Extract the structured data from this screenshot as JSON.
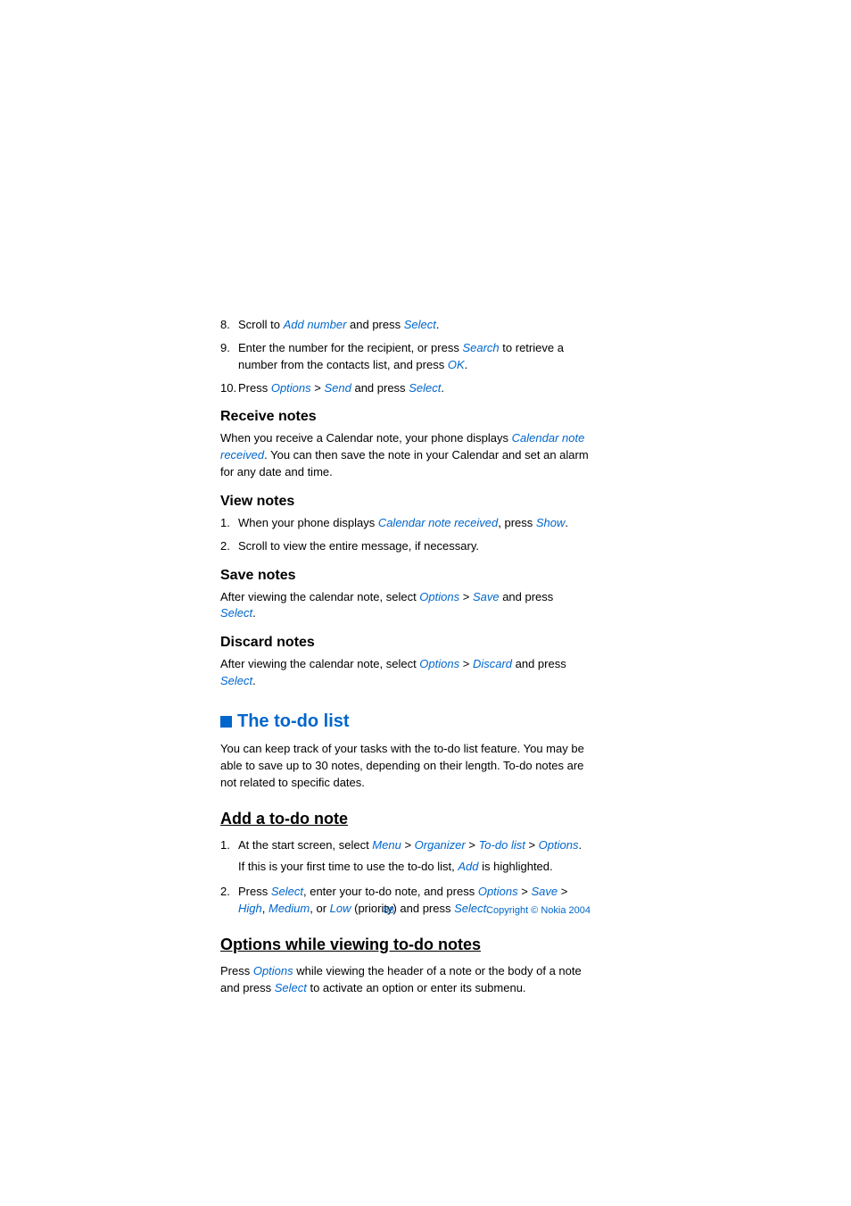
{
  "step8": {
    "num": "8.",
    "t1": "Scroll to ",
    "link1": "Add number",
    "t2": " and press ",
    "link2": "Select",
    "t3": "."
  },
  "step9": {
    "num": "9.",
    "t1": "Enter the number for the recipient, or press ",
    "link1": "Search",
    "t2": " to retrieve a number from the contacts list, and press ",
    "link2": "OK",
    "t3": "."
  },
  "step10": {
    "num": "10.",
    "t1": "Press ",
    "link1": "Options",
    "gt1": " > ",
    "link2": "Send",
    "t2": " and press ",
    "link3": "Select",
    "t3": "."
  },
  "receive": {
    "heading": "Receive notes",
    "t1": "When you receive a Calendar note, your phone displays ",
    "link1": "Calendar note received",
    "t2": ". You can then save the note in your Calendar and set an alarm for any date and time."
  },
  "view": {
    "heading": "View notes",
    "s1": {
      "num": "1.",
      "t1": "When your phone displays ",
      "link1": "Calendar note received",
      "t2": ", press ",
      "link2": "Show",
      "t3": "."
    },
    "s2": {
      "num": "2.",
      "t1": "Scroll to view the entire message, if necessary."
    }
  },
  "save": {
    "heading": "Save notes",
    "t1": "After viewing the calendar note, select ",
    "link1": "Options",
    "gt1": " > ",
    "link2": "Save",
    "t2": " and press ",
    "link3": "Select",
    "t3": "."
  },
  "discard": {
    "heading": "Discard notes",
    "t1": "After viewing the calendar note, select ",
    "link1": "Options",
    "gt1": " > ",
    "link2": "Discard",
    "t2": " and press ",
    "link3": "Select",
    "t3": "."
  },
  "todo": {
    "title": "The to-do list",
    "intro": "You can keep track of your tasks with the to-do list feature. You may be able to save up to 30 notes, depending on their length. To-do notes are not related to specific dates."
  },
  "addnote": {
    "heading": "Add a to-do note",
    "s1": {
      "num": "1.",
      "t1": "At the start screen, select ",
      "link1": "Menu",
      "gt1": " > ",
      "link2": "Organizer",
      "gt2": " > ",
      "link3": "To-do list",
      "gt3": " > ",
      "link4": "Options",
      "t2": ".",
      "sub_t1": "If this is your first time to use the to-do list, ",
      "sub_link1": "Add",
      "sub_t2": " is highlighted."
    },
    "s2": {
      "num": "2.",
      "t1": "Press ",
      "link1": "Select",
      "t2": ", enter your to-do note, and press ",
      "link2": "Options",
      "gt1": " > ",
      "link3": "Save",
      "gt2": " > ",
      "link4": "High",
      "t3": ", ",
      "link5": "Medium",
      "t4": ", or ",
      "link6": "Low",
      "t5": " (priority) and press ",
      "link7": "Select",
      "t6": "."
    }
  },
  "optionsview": {
    "heading": "Options while viewing to-do notes",
    "t1": "Press ",
    "link1": "Options",
    "t2": " while viewing the header of a note or the body of a note and press ",
    "link2": "Select",
    "t3": " to activate an option or enter its submenu."
  },
  "footer": {
    "page": "88",
    "copy": "Copyright © Nokia 2004"
  }
}
